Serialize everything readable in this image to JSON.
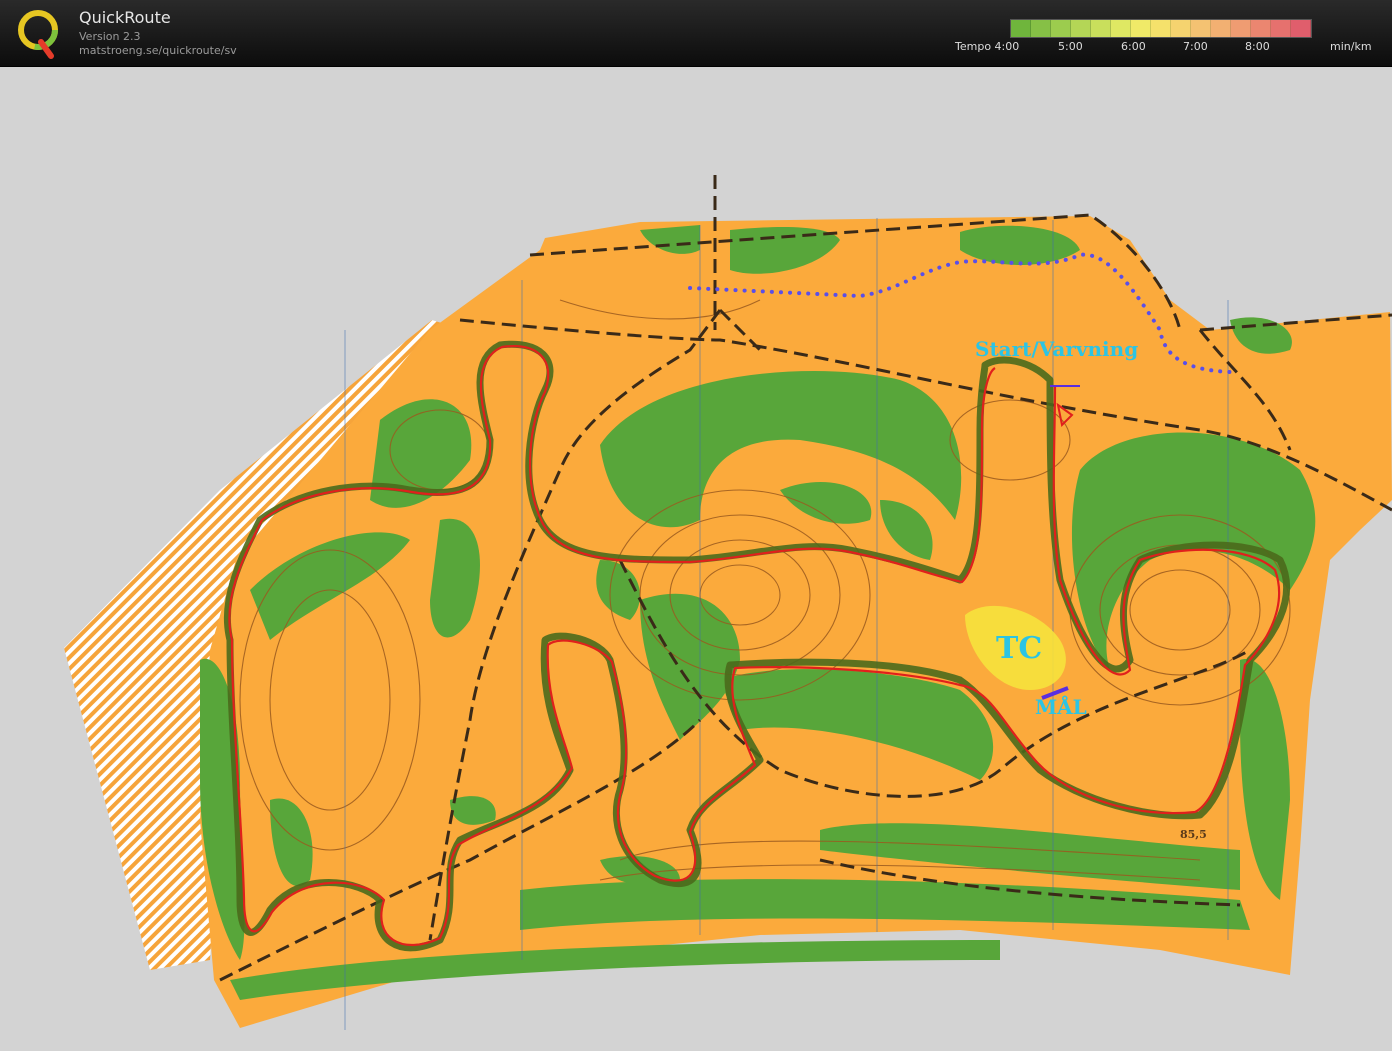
{
  "app": {
    "title": "QuickRoute",
    "version": "Version 2.3",
    "url": "matstroeng.se/quickroute/sv",
    "logo_letter": "Q"
  },
  "legend": {
    "tempo_label": "Tempo",
    "ticks": [
      "4:00",
      "5:00",
      "6:00",
      "7:00",
      "8:00"
    ],
    "unit": "min/km",
    "colors": [
      "#6fb53c",
      "#86c046",
      "#9ccc4e",
      "#b4d656",
      "#c9df5c",
      "#dfe863",
      "#f0ea68",
      "#f5e16b",
      "#f5d36f",
      "#f4c272",
      "#f2b072",
      "#ef9c72",
      "#eb8670",
      "#e6716e",
      "#e05e6c"
    ]
  },
  "map": {
    "labels": {
      "start": "Start/Varvning",
      "tc": "TC",
      "finish": "MÅL",
      "height": "85,5"
    },
    "colors": {
      "open_land": "#fbaa3c",
      "forest": "#58a63a",
      "contour": "#9a5a1e",
      "route": "#e0201c",
      "gps_track": "#4b6a1c",
      "path": "#3a2a18",
      "dotted_boundary": "#5a4fe8",
      "annotation": "#2cc4e4",
      "tc_area": "#f6e23c"
    }
  }
}
